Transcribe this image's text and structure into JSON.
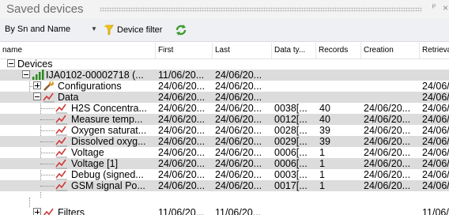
{
  "panel": {
    "title": "Saved devices",
    "pin_glyph": "p",
    "close_glyph": "×"
  },
  "toolbar": {
    "sort_label": "By Sn and Name",
    "filter_label": "Device filter"
  },
  "columns": [
    "name",
    "First",
    "Last",
    "Data ty...",
    "Records",
    "Creation",
    "Retrieva"
  ],
  "rows": [
    {
      "name": "Devices",
      "first": "",
      "last": "",
      "datatype": "",
      "records": "",
      "creation": "",
      "retrieval": ""
    },
    {
      "name": "IJA0102-00002718 (...",
      "first": "11/06/20...",
      "last": "24/06/20...",
      "datatype": "",
      "records": "",
      "creation": "",
      "retrieval": ""
    },
    {
      "name": "Configurations",
      "first": "24/06/20...",
      "last": "24/06/20...",
      "datatype": "",
      "records": "",
      "creation": "",
      "retrieval": "24/06/"
    },
    {
      "name": "Data",
      "first": "24/06/20...",
      "last": "24/06/20...",
      "datatype": "",
      "records": "",
      "creation": "",
      "retrieval": "24/06/"
    },
    {
      "name": "H2S Concentra...",
      "first": "24/06/20...",
      "last": "24/06/20...",
      "datatype": "0038[...",
      "records": "40",
      "creation": "24/06/20...",
      "retrieval": "24/06/"
    },
    {
      "name": "Measure temp...",
      "first": "24/06/20...",
      "last": "24/06/20...",
      "datatype": "0012[...",
      "records": "40",
      "creation": "24/06/20...",
      "retrieval": "24/06/"
    },
    {
      "name": "Oxygen saturat...",
      "first": "24/06/20...",
      "last": "24/06/20...",
      "datatype": "0028[...",
      "records": "39",
      "creation": "24/06/20...",
      "retrieval": "24/06/"
    },
    {
      "name": "Dissolved oxyg...",
      "first": "24/06/20...",
      "last": "24/06/20...",
      "datatype": "0029[...",
      "records": "39",
      "creation": "24/06/20...",
      "retrieval": "24/06/"
    },
    {
      "name": "Voltage",
      "first": "24/06/20...",
      "last": "24/06/20...",
      "datatype": "0006[...",
      "records": "1",
      "creation": "24/06/20...",
      "retrieval": "24/06/"
    },
    {
      "name": "Voltage [1]",
      "first": "24/06/20...",
      "last": "24/06/20...",
      "datatype": "0006[...",
      "records": "1",
      "creation": "24/06/20...",
      "retrieval": "24/06/"
    },
    {
      "name": "Debug (signed...",
      "first": "24/06/20...",
      "last": "24/06/20...",
      "datatype": "0003[...",
      "records": "1",
      "creation": "24/06/20...",
      "retrieval": "24/06/"
    },
    {
      "name": "GSM signal Po...",
      "first": "24/06/20...",
      "last": "24/06/20...",
      "datatype": "0017[...",
      "records": "1",
      "creation": "24/06/20...",
      "retrieval": "24/06/"
    },
    {
      "name": "Filters",
      "first": "11/06/20...",
      "last": "11/06/20...",
      "datatype": "",
      "records": "",
      "creation": "",
      "retrieval": "11/06/"
    }
  ]
}
